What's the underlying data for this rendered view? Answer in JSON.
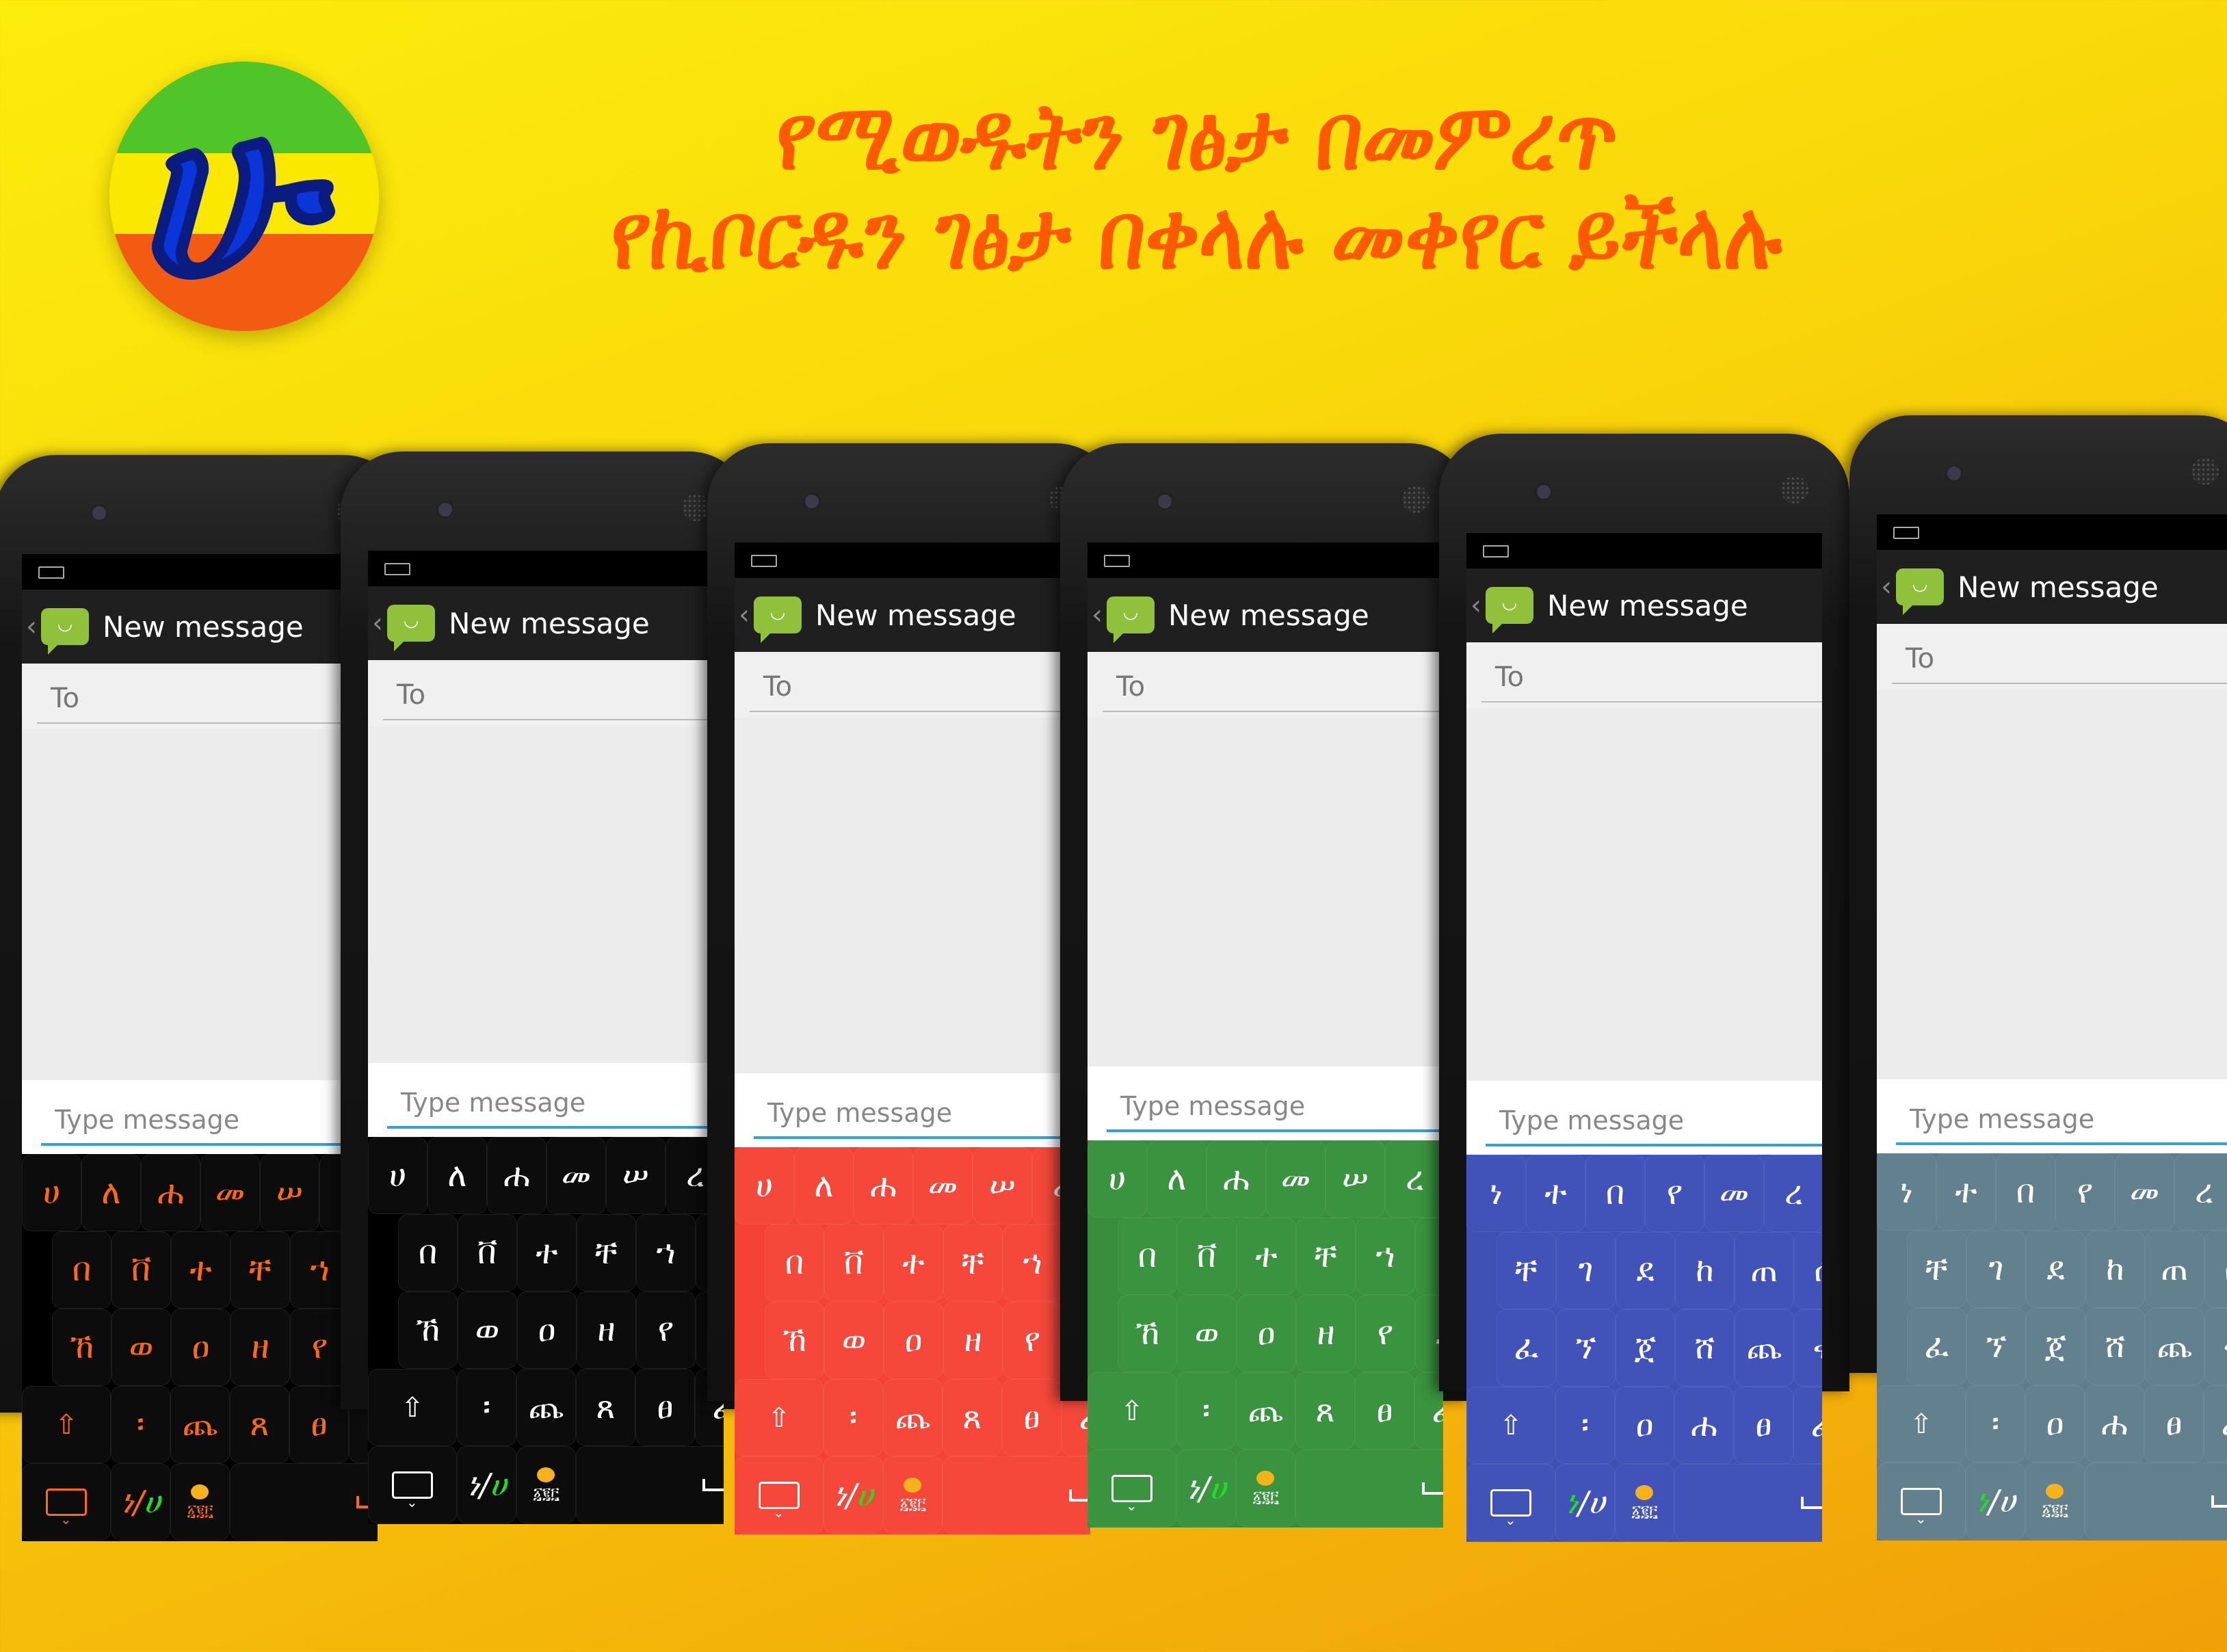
{
  "logo": {
    "glyph": "ሁ",
    "stripe_colors": [
      "#4fc52a",
      "#fbe800",
      "#f35b12"
    ],
    "glyph_color": "#0a35d8"
  },
  "headline": {
    "line1": "የሚወዱትን ገፅታ በመምረጥ",
    "line2": "የኪቦርዱን ገፅታ በቀላሉ መቀየር ይችላሉ",
    "color": "#ff5a00"
  },
  "app": {
    "title": "New message",
    "to_placeholder": "To",
    "message_placeholder": "Type message",
    "back_icon": "chevron-left-icon",
    "app_icon": "message-bubble-smile-icon"
  },
  "layouts": {
    "A": [
      [
        "ሀ",
        "ለ",
        "ሐ",
        "መ",
        "ሠ",
        "ረ"
      ],
      [
        "በ",
        "ቨ",
        "ተ",
        "ቸ",
        "ኀ",
        "ነ"
      ],
      [
        "ኸ",
        "ወ",
        "ዐ",
        "ዘ",
        "የ",
        "ደ"
      ],
      [
        "፡",
        "ጨ",
        "ጸ",
        "ፀ",
        "ፈ"
      ]
    ],
    "B": [
      [
        "ነ",
        "ተ",
        "በ",
        "የ",
        "መ",
        "ረ"
      ],
      [
        "ቸ",
        "ገ",
        "ደ",
        "ከ",
        "ጠ",
        "ሰ"
      ],
      [
        "ፈ",
        "ኘ",
        "ጀ",
        "ሸ",
        "ጨ",
        "ቀ"
      ],
      [
        "፡",
        "ዐ",
        "ሐ",
        "ፀ",
        "ፈ"
      ]
    ]
  },
  "bottom_row": {
    "switch_left": "ነ",
    "switch_sep": "/",
    "switch_right": "ሀ",
    "numbers": "፩፪፫",
    "switch_accent": "#22dd22"
  },
  "phones": [
    {
      "theme": "black-orange",
      "bg": "#000000",
      "key": "#0c0c0c",
      "text": "#ff6a10",
      "layout": "A",
      "accent": "right"
    },
    {
      "theme": "black-white",
      "bg": "#000000",
      "key": "#0c0c0c",
      "text": "#ffffff",
      "layout": "A",
      "accent": "right"
    },
    {
      "theme": "red",
      "bg": "#f44336",
      "key": "#f5483b",
      "text": "#ffffff",
      "layout": "A",
      "accent": "right"
    },
    {
      "theme": "green",
      "bg": "#388e3c",
      "key": "#3a933e",
      "text": "#ffffff",
      "layout": "A",
      "accent": "right"
    },
    {
      "theme": "blue",
      "bg": "#3f51b5",
      "key": "#4153b8",
      "text": "#ffffff",
      "layout": "B",
      "accent": "left"
    },
    {
      "theme": "blue-grey",
      "bg": "#607d8b",
      "key": "#62808e",
      "text": "#ffffff",
      "layout": "B",
      "accent": "left"
    }
  ]
}
